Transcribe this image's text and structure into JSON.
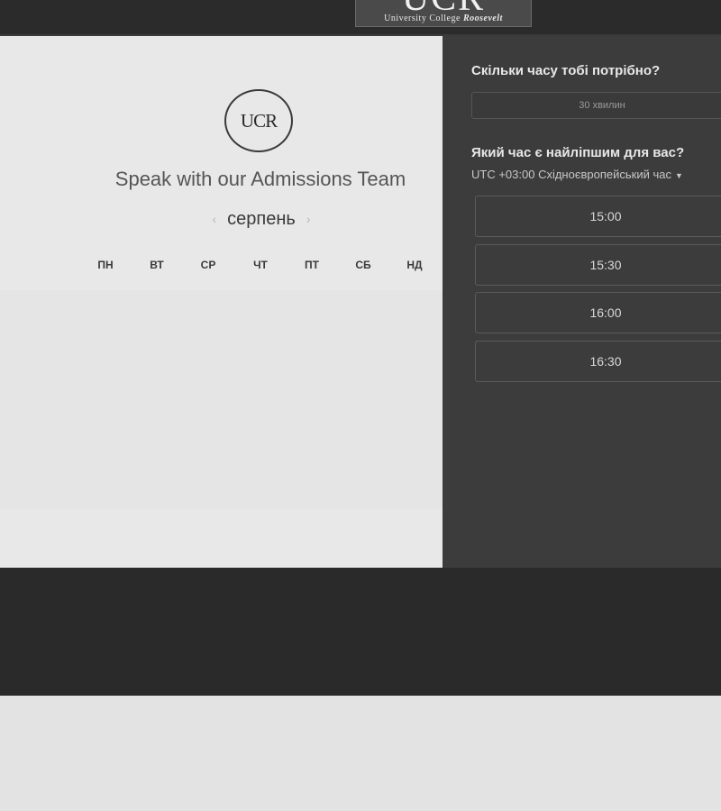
{
  "header": {
    "logo_text": "UCR",
    "logo_subtitle_prefix": "University College",
    "logo_subtitle_name": "Roosevelt"
  },
  "booking": {
    "badge_text": "UCR",
    "title": "Speak with our Admissions Team",
    "month": "серпень",
    "weekdays": [
      "ПН",
      "ВТ",
      "СР",
      "ЧТ",
      "ПТ",
      "СБ",
      "НД"
    ]
  },
  "sidebar": {
    "duration_question": "Скільки часу тобі потрібно?",
    "duration_value": "30 хвилин",
    "time_question": "Який час є найліпшим для вас?",
    "timezone": "UTC +03:00 Східноєвропейський час",
    "slots": [
      "15:00",
      "15:30",
      "16:00",
      "16:30"
    ]
  },
  "colors": {
    "dark_bg": "#2b2b2b",
    "sidebar_bg": "#3c3c3c",
    "panel_bg": "#e8e8e8"
  }
}
